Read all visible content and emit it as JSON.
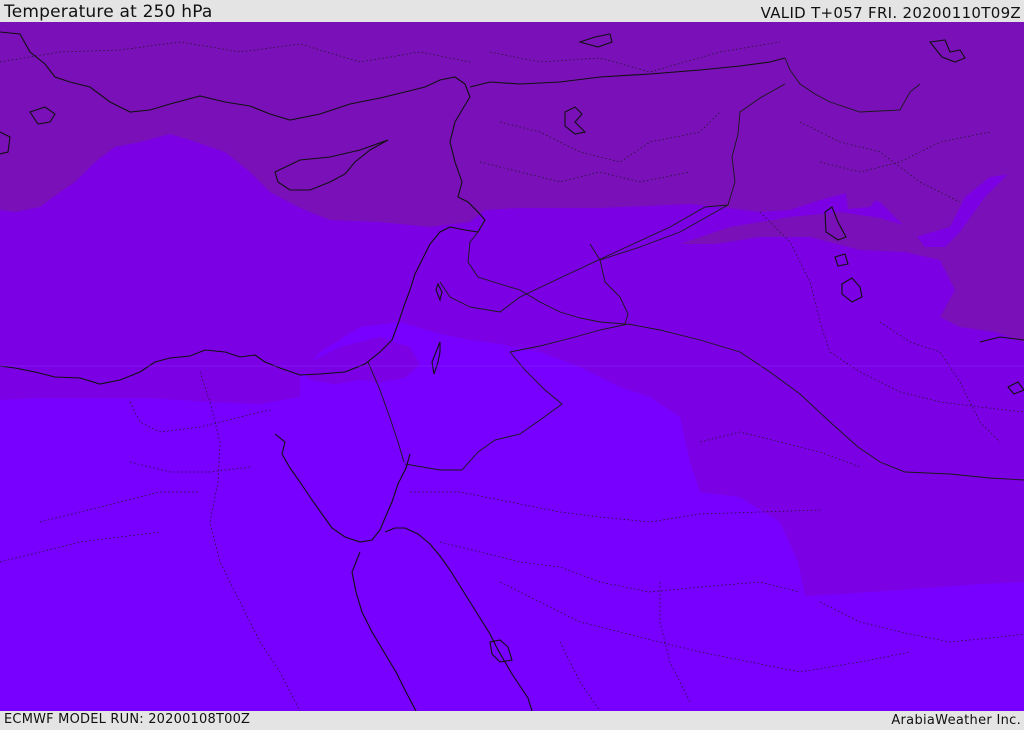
{
  "header": {
    "title": "Temperature at 250 hPa",
    "valid": "VALID T+057 FRI. 20200110T09Z"
  },
  "footer": {
    "model_run": "ECMWF MODEL RUN: 20200108T00Z",
    "credit": "ArabiaWeather Inc."
  },
  "map": {
    "variable": "temperature",
    "level_hpa": 250,
    "colors": {
      "band_warm": "#7800ff",
      "band_mid": "#7c00e4",
      "band_cool": "#7a10b8",
      "coastline": "#111111",
      "border": "#1a1a1a"
    }
  }
}
